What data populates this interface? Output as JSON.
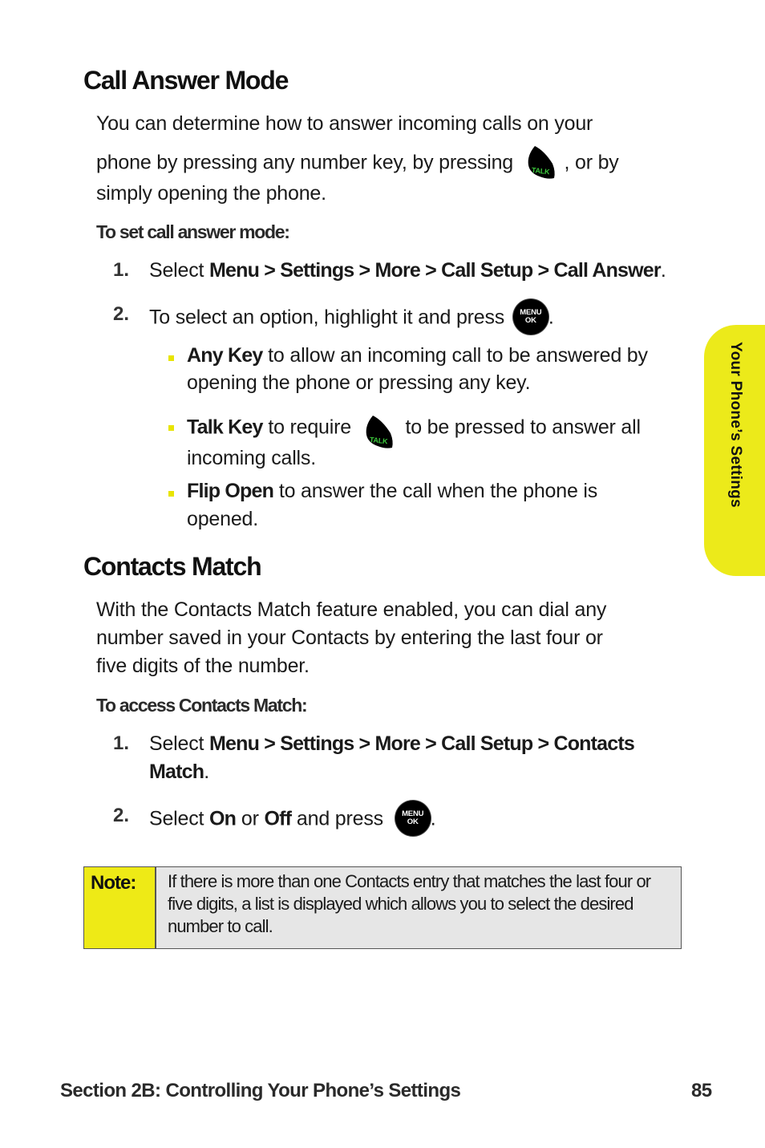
{
  "section1": {
    "title": "Call Answer Mode",
    "intro_part1": "You can determine how to answer incoming calls on your",
    "intro_part2": "phone by pressing any number key, by pressing",
    "intro_part3": ", or by",
    "intro_part4": "simply opening the phone.",
    "subhead": "To set call answer mode:",
    "steps": [
      {
        "num": "1.",
        "pre": "Select ",
        "path": "Menu > Settings > More > Call Setup > Call Answer",
        "post": "."
      },
      {
        "num": "2.",
        "pre": "To select an option, highlight it and press",
        "post": "."
      }
    ],
    "options": [
      {
        "name": "Any Key",
        "line1": " to allow an incoming call to be answered by",
        "line2": "opening the phone or pressing any key."
      },
      {
        "name": "Talk Key",
        "line1a": " to require",
        "line1b": "to be pressed to answer all",
        "line2": "incoming calls."
      },
      {
        "name": "Flip Open",
        "line1": " to answer the call when the phone is",
        "line2": "opened."
      }
    ]
  },
  "section2": {
    "title": "Contacts Match",
    "intro_line1": "With the Contacts Match feature enabled, you can dial any",
    "intro_line2": "number saved in your Contacts by entering the last four or",
    "intro_line3": "five digits of the number.",
    "subhead": "To access Contacts Match:",
    "step1": {
      "num": "1.",
      "pre": "Select ",
      "path_line1": "Menu > Settings > More > Call Setup > Contacts",
      "path_line2": "Match",
      "post": "."
    },
    "step2": {
      "num": "2.",
      "pre": "Select ",
      "on": "On",
      "or": " or ",
      "off": "Off",
      "post": " and press",
      "end": "."
    }
  },
  "keys": {
    "talk_label": "TALK",
    "menu_label_top": "MENU",
    "menu_label_bottom": "OK"
  },
  "note": {
    "label": "Note:",
    "text": "If there is more than one Contacts entry that matches the last four or five digits, a list is displayed which allows you to select the desired number to call."
  },
  "side_tab": {
    "label": "Your Phone’s Settings"
  },
  "footer": {
    "section": "Section 2B: Controlling Your Phone’s Settings",
    "page": "85"
  },
  "colors": {
    "accent_yellow": "#ECEA1A",
    "talk_green": "#3CC83C"
  }
}
